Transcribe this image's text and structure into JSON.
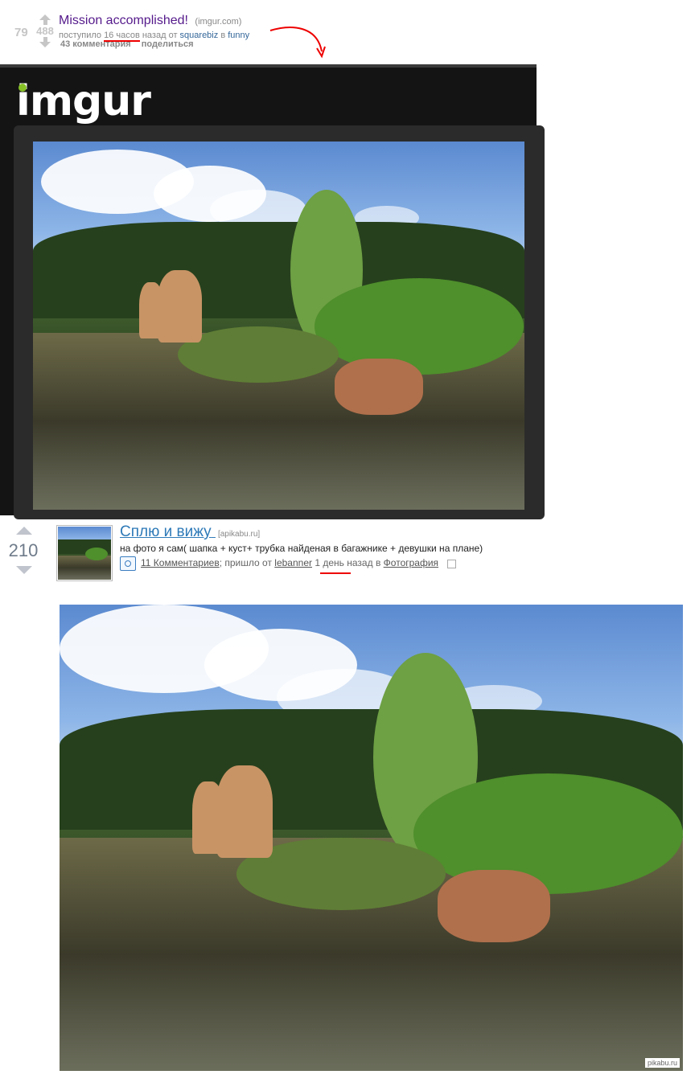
{
  "reddit": {
    "left_score": "79",
    "score": "488",
    "title": "Mission accomplished!",
    "domain": "(imgur.com)",
    "tagline_prefix": "поступило",
    "time": "16 часов",
    "tagline_mid": "назад от",
    "author": "squarebiz",
    "tagline_in": "в",
    "subreddit": "funny",
    "comments": "43 комментария",
    "share": "поделиться"
  },
  "imgur": {
    "logo": "imgur",
    "logo_color": "#85bf25"
  },
  "pikabu": {
    "score": "210",
    "title": "Сплю и вижу",
    "domain": "[apikabu.ru]",
    "description": "на фото я сам( шапка + куст+ трубка найденая в багажнике + девушки на плане)",
    "comments": "11 Комментариев",
    "from_label": "; пришло от",
    "author": "lebanner",
    "time": "1 день",
    "time_suffix": "назад в",
    "category": "Фотография",
    "watermark": "pikabu.ru"
  },
  "icons": [
    "arrow-up-icon",
    "arrow-down-icon",
    "camera-icon",
    "save-icon",
    "red-arrow-annotation"
  ],
  "colors": {
    "red_annotation": "#e00000",
    "pikabu_link": "#2e7ab8",
    "reddit_title": "#551a8b"
  }
}
